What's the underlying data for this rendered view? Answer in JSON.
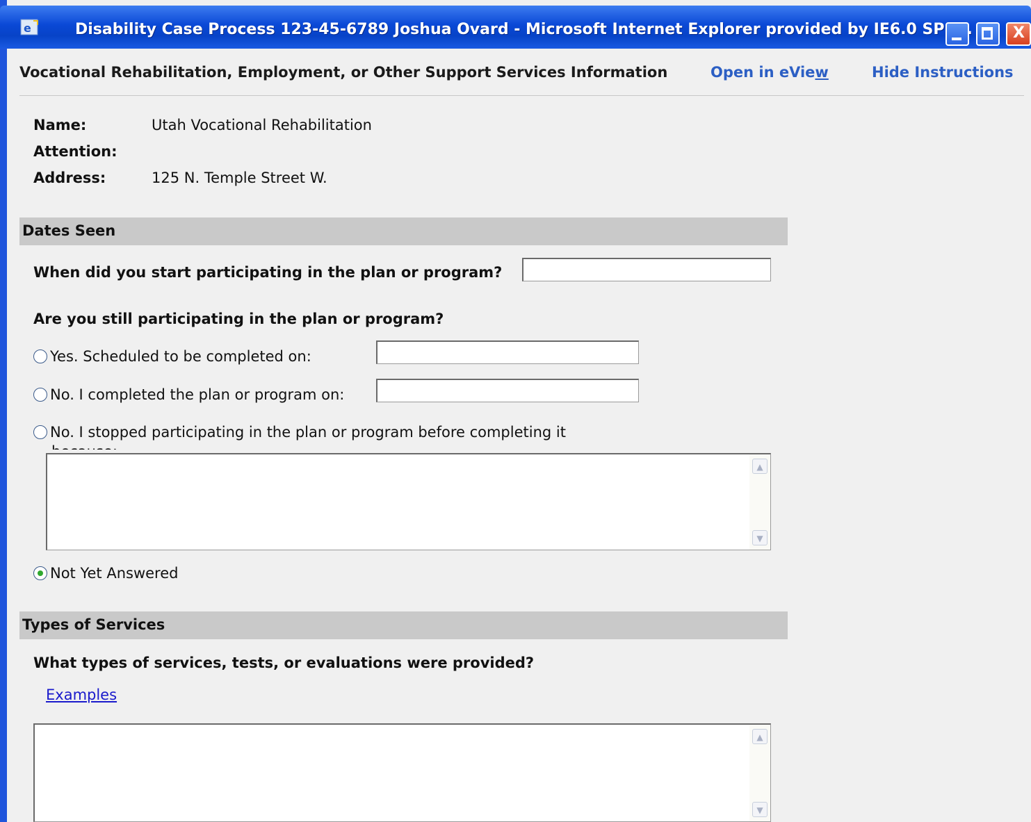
{
  "window": {
    "title": "Disability Case Process 123-45-6789 Joshua Ovard  -  Microsoft Internet Explorer provided by IE6.0 SP1...",
    "icon": "ie-icon",
    "controls": [
      "minimize",
      "maximize",
      "close"
    ],
    "close_glyph": "X"
  },
  "header": {
    "title": "Vocational Rehabilitation, Employment, or Other Support Services Information",
    "open_link_prefix": "Open in eVie",
    "open_link_underlined": "w",
    "hide_link": "Hide Instructions"
  },
  "info": {
    "name_label": "Name:",
    "name_value": "Utah Vocational Rehabilitation",
    "attention_label": "Attention:",
    "attention_value": "",
    "address_label": "Address:",
    "address_value": "125 N. Temple Street W."
  },
  "dates_section": {
    "heading": "Dates Seen",
    "start_question": "When did you start participating in the plan or program?",
    "start_value": "",
    "still_question": "Are you still participating in the plan or program?",
    "options": [
      {
        "label": "Yes.  Scheduled to be completed on:",
        "checked": false,
        "date_value": ""
      },
      {
        "label": "No.  I completed the plan or program on:",
        "checked": false,
        "date_value": ""
      },
      {
        "label": "No.  I stopped participating in the plan or program before completing it",
        "checked": false
      },
      {
        "label": "Not Yet Answered",
        "checked": true
      }
    ],
    "reason_overflow": "because:",
    "reason_value": ""
  },
  "services_section": {
    "heading": "Types of Services",
    "question": "What types of services, tests, or evaluations were provided?",
    "examples_link": "Examples",
    "services_value": ""
  },
  "colors": {
    "titlebar": "#0a48d6",
    "section_bar": "#c9c9c9",
    "link": "#2c5fc4",
    "background": "#f0f0f0"
  }
}
